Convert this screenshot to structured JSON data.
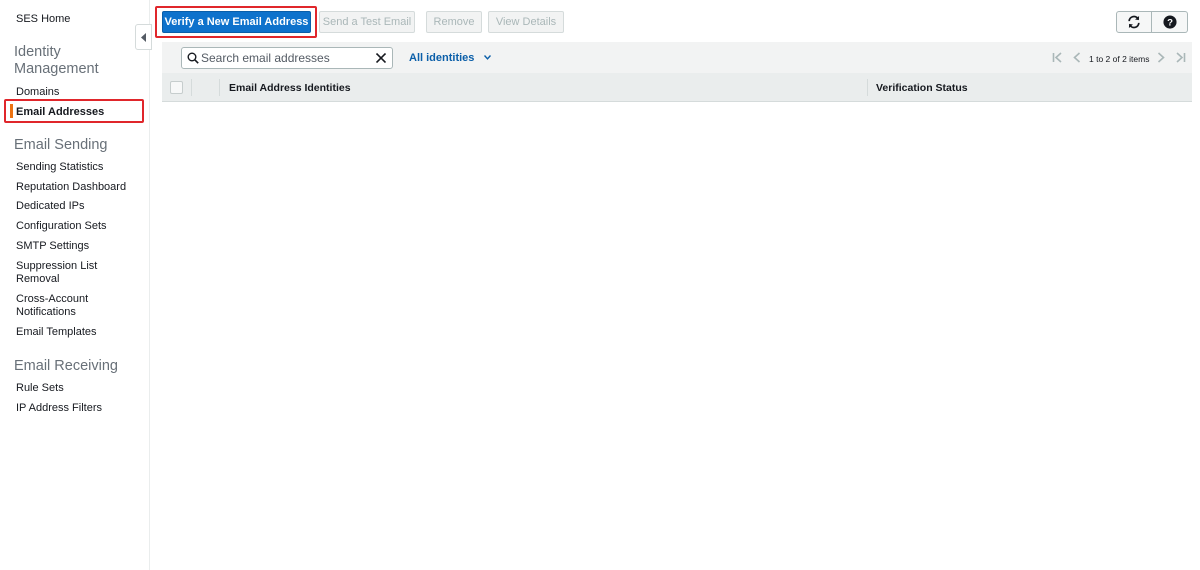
{
  "sidebar": {
    "home": "SES Home",
    "identity_section": [
      "Identity",
      "Management"
    ],
    "identity_items": [
      "Domains",
      "Email Addresses"
    ],
    "sending_section": "Email Sending",
    "sending_items": [
      "Sending Statistics",
      "Reputation Dashboard",
      "Dedicated IPs",
      "Configuration Sets",
      "SMTP Settings",
      "Suppression List",
      "Removal",
      "Cross-Account",
      "Notifications",
      "Email Templates"
    ],
    "receiving_section": "Email Receiving",
    "receiving_items": [
      "Rule Sets",
      "IP Address Filters"
    ],
    "active_color": "#ec7211"
  },
  "actions": {
    "verify": "Verify a New Email Address",
    "send_test": "Send a Test Email",
    "remove": "Remove",
    "view_details": "View Details",
    "refresh_icon": "refresh-icon",
    "help_icon": "help-icon"
  },
  "toolbar": {
    "search_placeholder": "Search email addresses",
    "filter_label": "All identities",
    "pagination": "1 to 2 of 2 items"
  },
  "table": {
    "columns": [
      "Email Address Identities",
      "Verification Status"
    ],
    "rows": []
  },
  "colors": {
    "primary": "#0e72cc",
    "link": "#0b5fa9",
    "highlight": "#e0262b"
  }
}
